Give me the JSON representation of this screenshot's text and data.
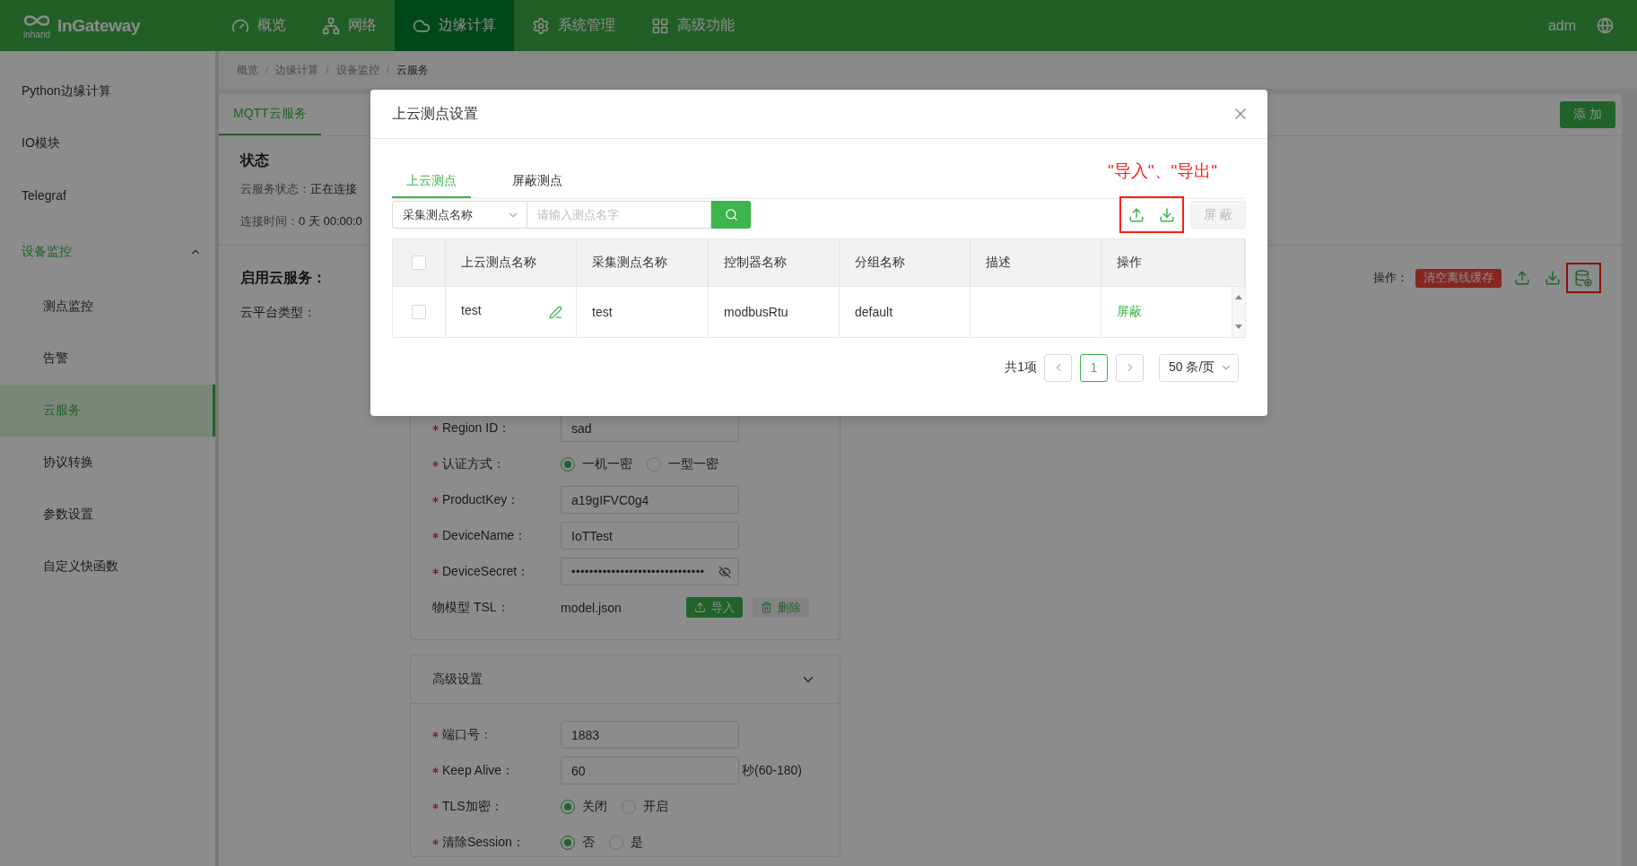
{
  "header": {
    "logo_text": "inhand",
    "brand": "InGateway",
    "nav": [
      {
        "label": "概览",
        "selected": false
      },
      {
        "label": "网络",
        "selected": false
      },
      {
        "label": "边缘计算",
        "selected": true
      },
      {
        "label": "系统管理",
        "selected": false
      },
      {
        "label": "高级功能",
        "selected": false
      }
    ],
    "user": "adm"
  },
  "sidebar": {
    "items": [
      {
        "label": "Python边缘计算",
        "selected": false
      },
      {
        "label": "IO模块",
        "selected": false
      },
      {
        "label": "Telegraf",
        "selected": false
      },
      {
        "label": "设备监控",
        "selected": false,
        "expanded": true,
        "children": [
          {
            "label": "测点监控",
            "selected": false
          },
          {
            "label": "告警",
            "selected": false
          },
          {
            "label": "云服务",
            "selected": true
          },
          {
            "label": "协议转换",
            "selected": false
          },
          {
            "label": "参数设置",
            "selected": false
          },
          {
            "label": "自定义快函数",
            "selected": false
          }
        ]
      }
    ]
  },
  "breadcrumb": [
    {
      "kind": "link",
      "label": "概览"
    },
    {
      "kind": "separator",
      "label": "/"
    },
    {
      "kind": "link",
      "label": "边缘计算"
    },
    {
      "kind": "separator",
      "label": "/"
    },
    {
      "kind": "link",
      "label": "设备监控"
    },
    {
      "kind": "separator",
      "label": "/"
    },
    {
      "kind": "current",
      "label": "云服务"
    }
  ],
  "page": {
    "tabs": [
      {
        "label": "MQTT云服务",
        "selected": true
      }
    ],
    "add_button": "添 加",
    "status": {
      "title": "状态",
      "lines": [
        {
          "label": "云服务状态：",
          "value": "正在连接"
        },
        {
          "label": "连接时间：",
          "value": "0 天 00:00:0"
        }
      ]
    },
    "cloud": {
      "title": "启用云服务：",
      "platform_label": "云平台类型：",
      "actions_label": "操作：",
      "clear_cache_button": "清空离线缓存",
      "cache_icon_highlighted": true,
      "fields": [
        {
          "kind": "input",
          "label": "Region ID：",
          "required": true,
          "value": "sad"
        },
        {
          "kind": "radio",
          "label": "认证方式：",
          "required": true,
          "options": [
            {
              "label": "一机一密",
              "selected": true
            },
            {
              "label": "一型一密",
              "selected": false
            }
          ]
        },
        {
          "kind": "input",
          "label": "ProductKey：",
          "required": true,
          "value": "a19gIFVC0g4"
        },
        {
          "kind": "input",
          "label": "DeviceName：",
          "required": true,
          "value": "IoTTest"
        },
        {
          "kind": "password",
          "label": "DeviceSecret：",
          "required": true,
          "value": "••••••••••••••••••••••••••••••"
        },
        {
          "kind": "file",
          "label": "物模型 TSL：",
          "required": false,
          "value": "model.json",
          "import_button": "导入",
          "delete_button": "删除"
        }
      ]
    },
    "advanced": {
      "title": "高级设置",
      "expanded": true,
      "fields": [
        {
          "kind": "input",
          "label": "端口号：",
          "required": true,
          "value": "1883"
        },
        {
          "kind": "input",
          "label": "Keep Alive：",
          "required": true,
          "value": "60",
          "suffix": "秒(60-180)"
        },
        {
          "kind": "radio",
          "label": "TLS加密：",
          "required": true,
          "options": [
            {
              "label": "关闭",
              "selected": true
            },
            {
              "label": "开启",
              "selected": false
            }
          ]
        },
        {
          "kind": "radio",
          "label": "清除Session：",
          "required": true,
          "options": [
            {
              "label": "否",
              "selected": true
            },
            {
              "label": "是",
              "selected": false
            }
          ]
        }
      ]
    }
  },
  "modal": {
    "title": "上云测点设置",
    "tabs": [
      {
        "label": "上云测点",
        "selected": true
      },
      {
        "label": "屏蔽测点",
        "selected": false
      }
    ],
    "annotation": "\"导入\"、\"导出\"",
    "filter": {
      "select": "采集测点名称",
      "placeholder": "请输入测点名字"
    },
    "toolbar": {
      "highlighted": true,
      "mask_button": {
        "label": "屏 蔽",
        "disabled": true
      }
    },
    "table": {
      "all_checked": false,
      "columns": [
        "上云测点名称",
        "采集测点名称",
        "控制器名称",
        "分组名称",
        "描述",
        "操作"
      ],
      "rows": [
        {
          "checked": false,
          "point_name": "test",
          "source_name": "test",
          "controller": "modbusRtu",
          "group": "default",
          "action": "屏蔽"
        }
      ]
    },
    "pagination": {
      "total": "共1项",
      "pages": [
        {
          "label": "1",
          "selected": true
        }
      ],
      "page_size": "50 条/页"
    }
  }
}
